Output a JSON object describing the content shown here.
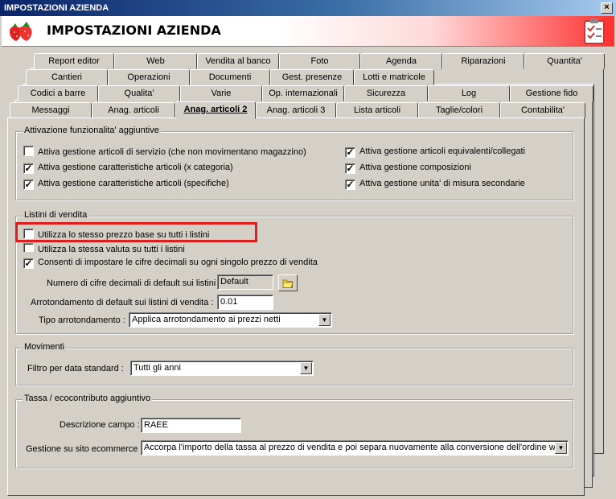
{
  "window": {
    "title": "IMPOSTAZIONI AZIENDA",
    "close_label": "×"
  },
  "header": {
    "title": "IMPOSTAZIONI AZIENDA"
  },
  "tabs": {
    "row1": [
      "Report editor",
      "Web",
      "Vendita al banco",
      "Foto",
      "Agenda",
      "Riparazioni",
      "Quantita'"
    ],
    "row2": [
      "Cantieri",
      "Operazioni",
      "Documenti",
      "Gest. presenze",
      "Lotti e matricole"
    ],
    "row3": [
      "Codici a barre",
      "Qualita'",
      "Varie",
      "Op. internazionali",
      "Sicurezza",
      "Log",
      "Gestione fido"
    ],
    "row4": [
      "Messaggi",
      "Anag. articoli",
      "Anag. articoli 2",
      "Anag. articoli 3",
      "Lista articoli",
      "Taglie/colori",
      "Contabilita'"
    ],
    "active": "Anag. articoli 2"
  },
  "group_features": {
    "legend": "Attivazione funzionalita' aggiuntive",
    "items": [
      {
        "label": "Attiva gestione articoli di servizio (che non movimentano magazzino)",
        "checked": false
      },
      {
        "label": "Attiva gestione caratteristiche articoli (x categoria)",
        "checked": true
      },
      {
        "label": "Attiva gestione caratteristiche articoli (specifiche)",
        "checked": true
      },
      {
        "label": "Attiva gestione articoli equivalenti/collegati",
        "checked": true
      },
      {
        "label": "Attiva gestione composizioni",
        "checked": true
      },
      {
        "label": "Attiva gestione unita' di misura secondarie",
        "checked": true
      }
    ]
  },
  "group_listini": {
    "legend": "Listini di vendita",
    "items": [
      {
        "label": "Utilizza lo stesso prezzo base su tutti i listini",
        "checked": false
      },
      {
        "label": "Utilizza la stessa valuta su tutti i listini",
        "checked": false
      },
      {
        "label": "Consenti di impostare le cifre decimali su ogni singolo prezzo di vendita",
        "checked": true
      }
    ],
    "decimals_label": "Numero di cifre decimali di default sui listini :",
    "decimals_value": "Default",
    "rounding_label": "Arrotondamento di default sui listini di vendita :",
    "rounding_value": "0.01",
    "rounding_type_label": "Tipo arrotondamento :",
    "rounding_type_value": "Applica arrotondamento ai prezzi netti"
  },
  "group_movimenti": {
    "legend": "Movimenti",
    "filter_label": "Filtro per data standard :",
    "filter_value": "Tutti gli anni"
  },
  "group_tassa": {
    "legend": "Tassa / ecocontributo aggiuntivo",
    "desc_label": "Descrizione campo :",
    "desc_value": "RAEE",
    "ecommerce_label": "Gestione su sito ecommerce :",
    "ecommerce_value": "Accorpa l'importo della tassa al prezzo di vendita e poi separa nuovamente alla conversione dell'ordine web"
  },
  "colors": {
    "highlight": "#e21b1b",
    "face": "#d4d0c8"
  }
}
